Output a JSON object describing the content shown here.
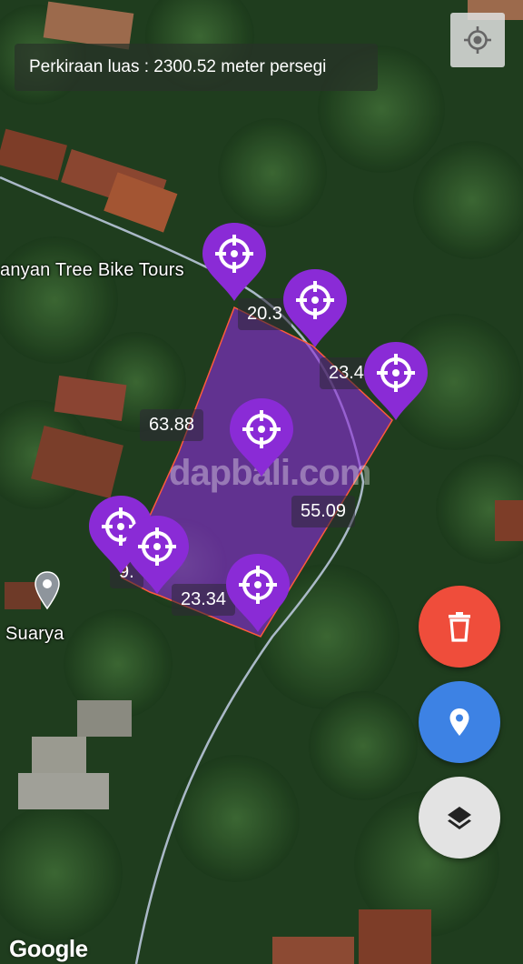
{
  "area_banner": {
    "text": "Perkiraan luas : 2300.52 meter persegi"
  },
  "places": [
    {
      "name": "anyan Tree Bike Tours"
    },
    {
      "name": "Suarya"
    }
  ],
  "segment_labels": [
    "20.3",
    "23.4",
    "63.88",
    "55.09",
    "9.",
    "23.34"
  ],
  "watermark": "dapbali.com",
  "attribution": "Google",
  "colors": {
    "marker": "#8a2bd6",
    "polygon_fill": "#8a2bd6",
    "polygon_stroke": "#ff5a3c",
    "delete_fab": "#ef4d3b",
    "add_point_fab": "#3d82e4",
    "layers_fab": "#e3e3e3"
  },
  "icons": {
    "locate": "crosshair-gps-icon",
    "marker": "target-crosshair-icon",
    "delete": "trash-icon",
    "add_point": "map-pin-icon",
    "layers": "layers-icon"
  }
}
